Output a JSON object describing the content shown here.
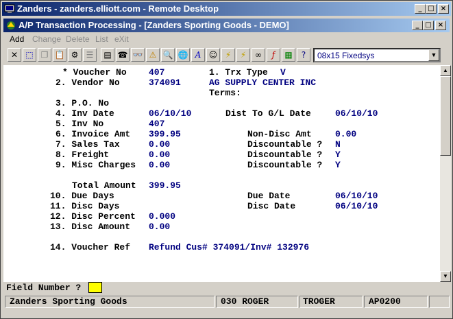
{
  "rd_window": {
    "title": "Zanders - zanders.elliott.com - Remote Desktop"
  },
  "app_window": {
    "title": "A/P Transaction Processing - [Zanders Sporting Goods - DEMO]"
  },
  "menu": {
    "add": "Add",
    "change": "Change",
    "delete": "Delete",
    "list": "List",
    "exit": "eXit"
  },
  "toolbar": {
    "font_value": "08x15 Fixedsys"
  },
  "form": {
    "voucher_label": "* Voucher No",
    "voucher_no": "407",
    "trx_type_label": "1. Trx Type",
    "trx_type": "V",
    "vendor_label": "2. Vendor No",
    "vendor_no": "374091",
    "vendor_name": "AG SUPPLY CENTER INC",
    "terms_label": "Terms:",
    "po_label": "3. P.O. No",
    "inv_date_label": "4. Inv Date",
    "inv_date": "06/10/10",
    "dist_gl_label": "Dist To G/L Date",
    "dist_gl_date": "06/10/10",
    "inv_no_label": "5. Inv No",
    "inv_no": "407",
    "invoice_amt_label": "6. Invoice Amt",
    "invoice_amt": "399.95",
    "non_disc_label": "Non-Disc Amt",
    "non_disc_amt": "0.00",
    "sales_tax_label": "7. Sales Tax",
    "sales_tax": "0.00",
    "disc1_label": "Discountable ?",
    "disc1": "N",
    "freight_label": "8. Freight",
    "freight": "0.00",
    "disc2_label": "Discountable ?",
    "disc2": "Y",
    "misc_label": "9. Misc Charges",
    "misc": "0.00",
    "disc3_label": "Discountable ?",
    "disc3": "Y",
    "total_label": "Total Amount",
    "total": "399.95",
    "due_days_label": "10. Due Days",
    "due_date_label": "Due Date",
    "due_date": "06/10/10",
    "disc_days_label": "11. Disc Days",
    "disc_date_label": "Disc Date",
    "disc_date": "06/10/10",
    "disc_pct_label": "12. Disc Percent",
    "disc_pct": "0.000",
    "disc_amt_label": "13. Disc Amount",
    "disc_amt": "0.00",
    "vref_label": "14. Voucher Ref",
    "vref": "Refund Cus# 374091/Inv# 132976"
  },
  "field_prompt": {
    "label": "Field Number ?"
  },
  "status": {
    "company": "Zanders Sporting Goods",
    "user": "030 ROGER",
    "login": "TROGER",
    "program": "AP0200"
  }
}
